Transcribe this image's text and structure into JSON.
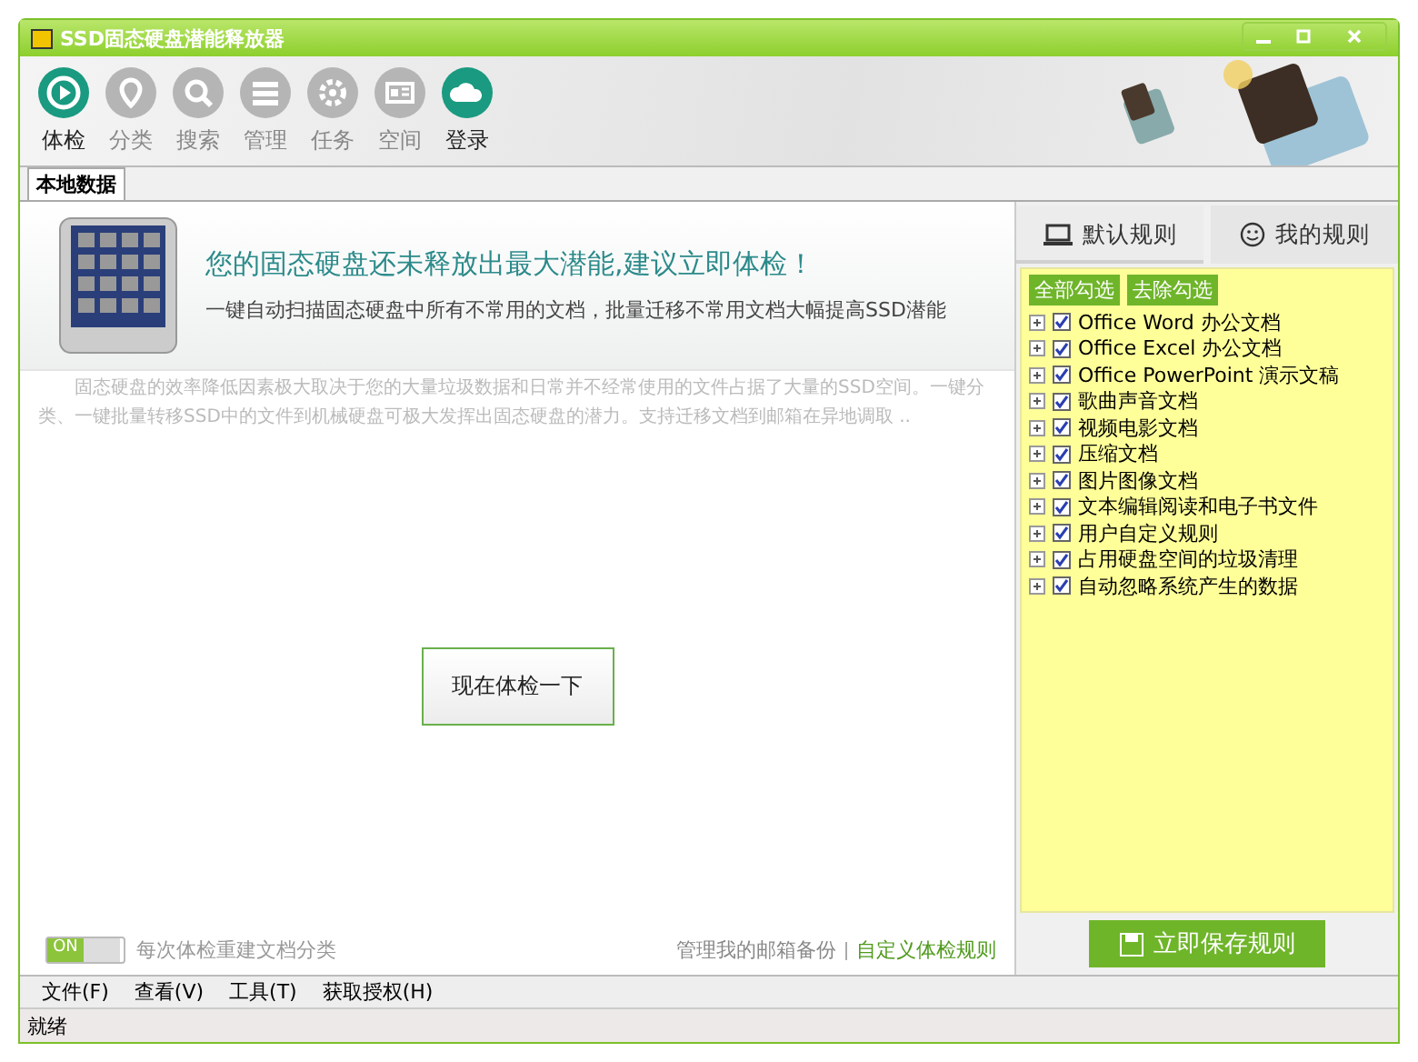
{
  "window": {
    "title": "SSD固态硬盘潜能释放器"
  },
  "toolbar": [
    {
      "label": "体检",
      "kind": "play",
      "disabled": false
    },
    {
      "label": "分类",
      "kind": "pin",
      "disabled": true
    },
    {
      "label": "搜索",
      "kind": "search",
      "disabled": true
    },
    {
      "label": "管理",
      "kind": "list",
      "disabled": true
    },
    {
      "label": "任务",
      "kind": "gear",
      "disabled": true
    },
    {
      "label": "空间",
      "kind": "card",
      "disabled": true
    },
    {
      "label": "登录",
      "kind": "cloud",
      "disabled": false
    }
  ],
  "tabs": [
    {
      "label": "本地数据",
      "selected": true
    }
  ],
  "banner": {
    "headline": "您的固态硬盘还未释放出最大潜能,建议立即体检！",
    "subtitle": "一键自动扫描固态硬盘中所有不常用的文档，批量迁移不常用文档大幅提高SSD潜能"
  },
  "description": "固态硬盘的效率降低因素极大取决于您的大量垃圾数据和日常并不经常使用的文件占据了大量的SSD空间。一键分类、一键批量转移SSD中的文件到机械硬盘可极大发挥出固态硬盘的潜力。支持迁移文档到邮箱在异地调取 ..",
  "check_button": "现在体检一下",
  "rebuild_toggle": {
    "state_label": "ON",
    "on": true,
    "label": "每次体检重建文档分类"
  },
  "links": [
    "管理我的邮箱备份",
    "自定义体检规则"
  ],
  "rule_tabs": [
    {
      "label": "默认规则",
      "kind": "laptop",
      "selected": true
    },
    {
      "label": "我的规则",
      "kind": "smiley",
      "selected": false
    }
  ],
  "rule_actions": [
    "全部勾选",
    "去除勾选"
  ],
  "rules": [
    {
      "label": "Office Word 办公文档",
      "checked": true
    },
    {
      "label": "Office Excel 办公文档",
      "checked": true
    },
    {
      "label": "Office PowerPoint 演示文稿",
      "checked": true
    },
    {
      "label": "歌曲声音文档",
      "checked": true
    },
    {
      "label": "视频电影文档",
      "checked": true
    },
    {
      "label": "压缩文档",
      "checked": true
    },
    {
      "label": "图片图像文档",
      "checked": true
    },
    {
      "label": "文本编辑阅读和电子书文件",
      "checked": true
    },
    {
      "label": "用户自定义规则",
      "checked": true
    },
    {
      "label": "占用硬盘空间的垃圾清理",
      "checked": true
    },
    {
      "label": "自动忽略系统产生的数据",
      "checked": true
    }
  ],
  "save_button": "立即保存规则",
  "menu": [
    "文件(F)",
    "查看(V)",
    "工具(T)",
    "获取授权(H)"
  ],
  "status_bar": "就绪"
}
